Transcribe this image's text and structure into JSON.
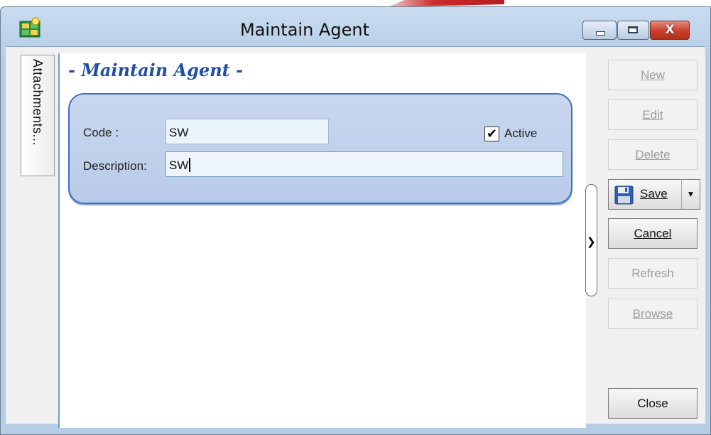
{
  "window": {
    "title": "Maintain Agent",
    "close_glyph": "X"
  },
  "sidetab": {
    "label": "Attachments..."
  },
  "form": {
    "heading": "- Maintain Agent -",
    "code_label": "Code :",
    "code_value": "SW",
    "description_label": "Description:",
    "description_value": "SW",
    "active_label": "Active",
    "active_checked": true,
    "check_glyph": "✔"
  },
  "actions": {
    "new": "New",
    "edit": "Edit",
    "delete": "Delete",
    "save": "Save",
    "cancel": "Cancel",
    "refresh": "Refresh",
    "browse": "Browse",
    "close": "Close"
  },
  "colors": {
    "heading": "#1e4fa8",
    "panel_border": "#3e6fc2",
    "close_button": "#c7402a"
  },
  "icons": [
    "app-icon",
    "minimize-icon",
    "maximize-icon",
    "close-icon",
    "checkbox-check-icon",
    "floppy-disk-icon",
    "chevron-down-icon",
    "chevron-right-icon"
  ]
}
